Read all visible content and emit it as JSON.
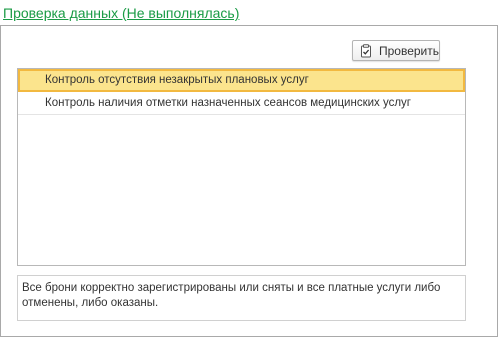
{
  "header": {
    "title": "Проверка данных (Не выполнялась)"
  },
  "toolbar": {
    "check_label": "Проверить",
    "check_icon": "clipboard-check-icon"
  },
  "checks": [
    {
      "label": "Контроль отсутствия незакрытых плановых услуг",
      "selected": true
    },
    {
      "label": "Контроль наличия отметки назначенных сеансов медицинских услуг",
      "selected": false
    }
  ],
  "result": {
    "message": "Все брони корректно зарегистрированы или сняты и все платные услуги либо отменены, либо оказаны."
  },
  "colors": {
    "title": "#1a9b45",
    "selected_fill": "#fbe48d",
    "selected_border": "#f2b940"
  }
}
